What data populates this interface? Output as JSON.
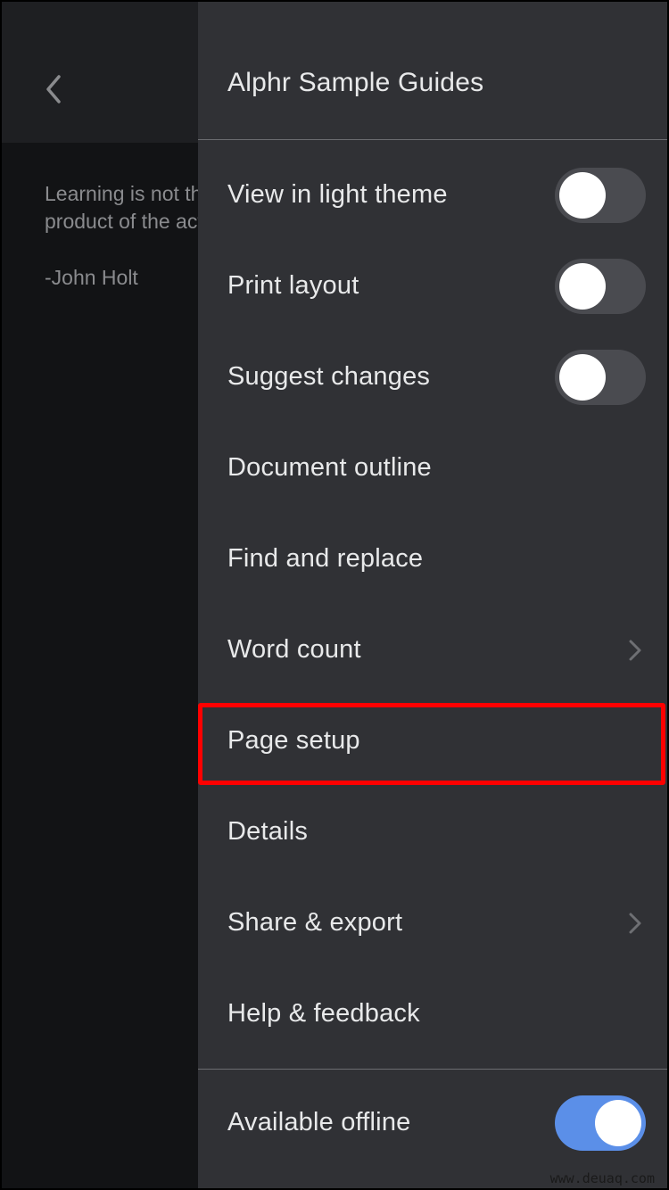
{
  "document": {
    "back_icon": "chevron-left-icon",
    "text_line1": "Learning is not the product of teaching. Learning is the",
    "text_line2": "product of the activity of learners.",
    "author": "-John Holt"
  },
  "menu": {
    "title": "Alphr Sample Guides",
    "items": [
      {
        "label": "View in light theme",
        "control": "toggle",
        "on": false
      },
      {
        "label": "Print layout",
        "control": "toggle",
        "on": false
      },
      {
        "label": "Suggest changes",
        "control": "toggle",
        "on": false
      },
      {
        "label": "Document outline",
        "control": "none"
      },
      {
        "label": "Find and replace",
        "control": "none"
      },
      {
        "label": "Word count",
        "control": "chevron"
      },
      {
        "label": "Page setup",
        "control": "none",
        "highlighted": true
      },
      {
        "label": "Details",
        "control": "none"
      },
      {
        "label": "Share & export",
        "control": "chevron"
      },
      {
        "label": "Help & feedback",
        "control": "none"
      }
    ],
    "footer_item": {
      "label": "Available offline",
      "control": "toggle",
      "on": true
    }
  },
  "colors": {
    "toggle_on": "#5b8fe8",
    "highlight": "#ff0000",
    "menu_bg": "#303135"
  },
  "watermark": "www.deuaq.com"
}
